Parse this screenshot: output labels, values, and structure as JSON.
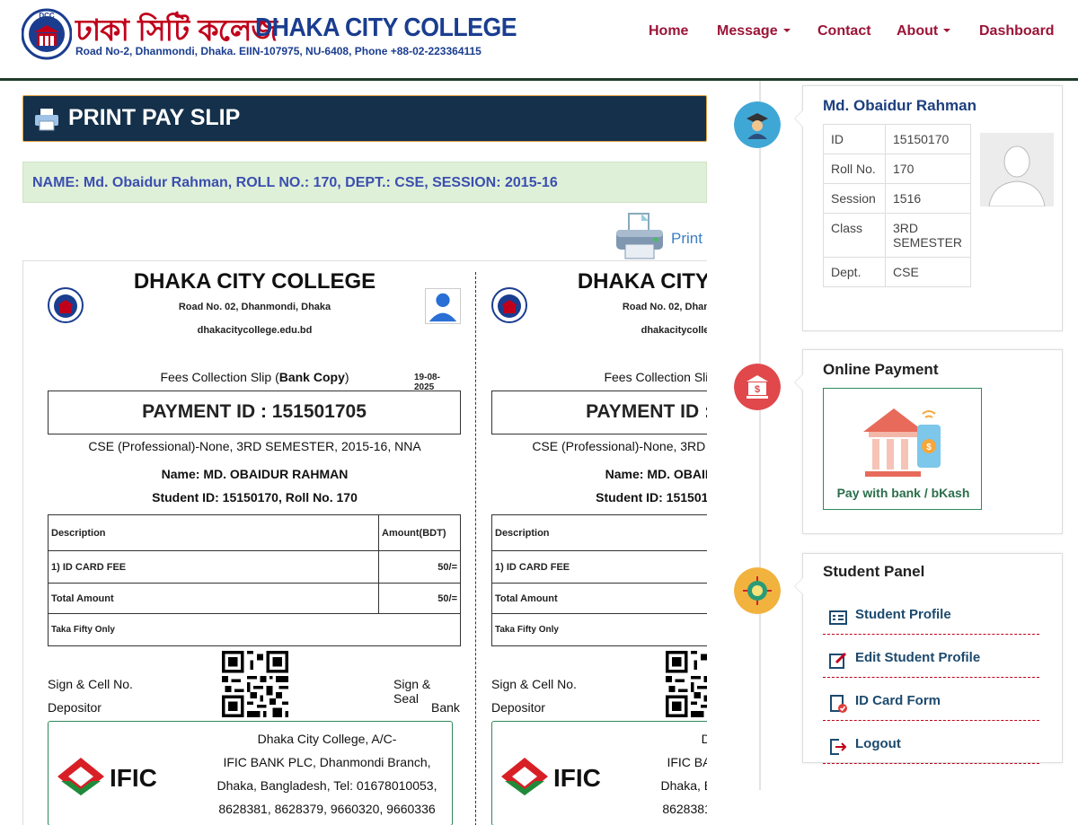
{
  "header": {
    "logo_text": "DCC",
    "college_name_bn": "ঢাকা সিটি কলেজ",
    "college_name_en": "DHAKA CITY COLLEGE",
    "address": "Road No-2, Dhanmondi, Dhaka. EIIN-107975, NU-6408, Phone +88-02-223364115",
    "nav": [
      {
        "label": "Home"
      },
      {
        "label": "Message"
      },
      {
        "label": "Contact"
      },
      {
        "label": "About"
      },
      {
        "label": "Dashboard"
      }
    ]
  },
  "main": {
    "title": "PRINT PAY SLIP",
    "name_line": "NAME: Md. Obaidur Rahman, ROLL NO.: 170, DEPT.: CSE, SESSION: 2015-16",
    "print_label": "Print"
  },
  "slip": {
    "college": "DHAKA CITY COLLEGE",
    "road": "Road No. 02, Dhanmondi, Dhaka",
    "website": "dhakacitycollege.edu.bd",
    "copy_prefix": "Fees Collection Slip (",
    "copy_bold": "Bank Copy",
    "copy_suffix": ")",
    "date": "19-08-2025",
    "payment_id": "PAYMENT ID : 151501705",
    "course": "CSE (Professional)-None, 3RD SEMESTER, 2015-16, NNA",
    "name": "Name: MD. OBAIDUR RAHMAN",
    "student": "Student ID: 15150170, Roll No. 170",
    "table": {
      "h_desc": "Description",
      "h_amt": "Amount(BDT)",
      "row_desc": "1) ID CARD FEE",
      "row_amt": "50/=",
      "total_desc": "Total Amount",
      "total_amt": "50/=",
      "words": "Taka Fifty Only"
    },
    "sign_left_1": "Sign & Cell No.",
    "sign_left_2": "Depositor",
    "sign_right_1": "Sign & Seal",
    "sign_right_2": "Bank",
    "bank_logo": "IFIC",
    "bank_lines": [
      "Dhaka City College, A/C-",
      "IFIC BANK PLC, Dhanmondi Branch,",
      "Dhaka, Bangladesh, Tel: 01678010053,",
      "8628381, 8628379, 9660320, 9660336"
    ]
  },
  "sidebar": {
    "profile": {
      "name": "Md. Obaidur Rahman",
      "rows": [
        {
          "k": "ID",
          "v": "15150170"
        },
        {
          "k": "Roll No.",
          "v": "170"
        },
        {
          "k": "Session",
          "v": "1516"
        },
        {
          "k": "Class",
          "v": "3RD SEMESTER"
        },
        {
          "k": "Dept.",
          "v": "CSE"
        }
      ]
    },
    "payment": {
      "title": "Online Payment",
      "button": "Pay with bank / bKash"
    },
    "panel": {
      "title": "Student Panel",
      "items": [
        {
          "label": "Student Profile"
        },
        {
          "label": "Edit Student Profile"
        },
        {
          "label": "ID Card Form"
        },
        {
          "label": "Logout"
        }
      ]
    }
  },
  "colors": {
    "brand_red": "#9b1437",
    "navy": "#14304a",
    "green": "#2f8a5b"
  }
}
